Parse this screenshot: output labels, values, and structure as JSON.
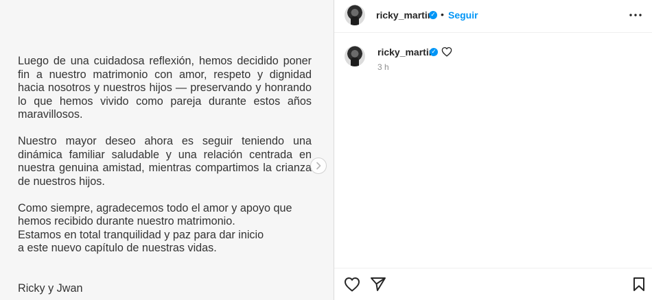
{
  "post": {
    "statement": {
      "p1": "Luego de una cuidadosa reflexión, hemos decidido poner fin a nuestro matrimonio con amor, respeto y dignidad hacia nosotros y nuestros hijos — preservando y honrando lo que hemos vivido como pareja durante estos años maravillosos.",
      "p2": "Nuestro mayor deseo ahora es seguir teniendo una dinámica familiar saludable y una relación centrada en nuestra genuina amistad, mientras compartimos la crianza de nuestros hijos.",
      "p3_lines": [
        "Como siempre, agradecemos todo el amor y apoyo que",
        "hemos recibido durante nuestro matrimonio.",
        "Estamos en total tranquilidad y paz para dar inicio",
        "a este nuevo capítulo de nuestras vidas."
      ],
      "signature": "Ricky y Jwan"
    },
    "next_icon": "chevron-right-icon"
  },
  "header": {
    "username": "ricky_martin",
    "separator": "•",
    "follow_label": "Seguir",
    "more_icon": "more-horizontal-icon"
  },
  "caption": {
    "username": "ricky_martin",
    "time": "3 h",
    "like_icon": "heart-outline-icon"
  },
  "actions": {
    "like_icon": "heart-outline-icon",
    "share_icon": "paper-plane-icon",
    "save_icon": "bookmark-outline-icon"
  },
  "colors": {
    "accent": "#0095f6",
    "text": "#262626",
    "muted": "#8e8e8e",
    "image_bg": "#f6f6f6"
  }
}
